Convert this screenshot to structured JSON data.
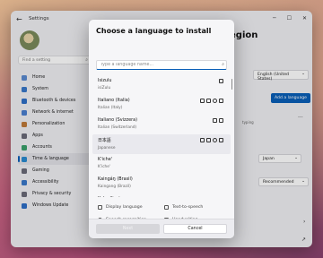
{
  "app": {
    "title": "Settings"
  },
  "window_controls": {
    "minimize": "─",
    "maximize": "☐",
    "close": "✕"
  },
  "sidebar": {
    "search_placeholder": "Find a setting",
    "items": [
      {
        "label": "Home",
        "color": "#5a8ad0"
      },
      {
        "label": "System",
        "color": "#3a78c9"
      },
      {
        "label": "Bluetooth & devices",
        "color": "#2e6fc7"
      },
      {
        "label": "Network & internet",
        "color": "#4a7fd0"
      },
      {
        "label": "Personalization",
        "color": "#c07a3a"
      },
      {
        "label": "Apps",
        "color": "#6a6a78"
      },
      {
        "label": "Accounts",
        "color": "#3aa06a"
      },
      {
        "label": "Time & language",
        "color": "#2a8ad0"
      },
      {
        "label": "Gaming",
        "color": "#6a6a78"
      },
      {
        "label": "Accessibility",
        "color": "#3a78c9"
      },
      {
        "label": "Privacy & security",
        "color": "#6a6a78"
      },
      {
        "label": "Windows Update",
        "color": "#2e6fc7"
      }
    ],
    "active_index": 7
  },
  "main": {
    "title_fragment": "egion",
    "windows_display_language": "English (United States)",
    "add_language_label": "Add a language",
    "typing_fragment": "typing",
    "country_value": "Japan",
    "format_value": "Recommended"
  },
  "dialog": {
    "title": "Choose a language to install",
    "search_placeholder": "Type a language name...",
    "languages": [
      {
        "name": "Isizulu",
        "sub": "isiZulu",
        "icons": [
          "handwriting"
        ]
      },
      {
        "name": "Italiano (Italia)",
        "sub": "Italian (Italy)",
        "icons": [
          "display",
          "tts",
          "speech",
          "handwriting"
        ]
      },
      {
        "name": "Italiano (Svizzera)",
        "sub": "Italian (Switzerland)",
        "icons": [
          "display",
          "handwriting"
        ]
      },
      {
        "name": "日本語",
        "sub": "Japanese",
        "icons": [
          "display",
          "tts",
          "speech",
          "handwriting"
        ]
      },
      {
        "name": "K'iche'",
        "sub": "K'iche'",
        "icons": []
      },
      {
        "name": "Kaingáŋ (Brasil)",
        "sub": "Kaingang (Brazil)",
        "icons": []
      },
      {
        "name": "Kalaallisut",
        "sub": "",
        "icons": [
          "handwriting"
        ]
      }
    ],
    "selected_index": 3,
    "legend": {
      "display_language": "Display language",
      "text_to_speech": "Text-to-speech",
      "speech_recognition": "Speech recognition",
      "handwriting": "Handwriting"
    },
    "next_label": "Next",
    "cancel_label": "Cancel"
  },
  "colors": {
    "accent": "#0a5fb8"
  }
}
